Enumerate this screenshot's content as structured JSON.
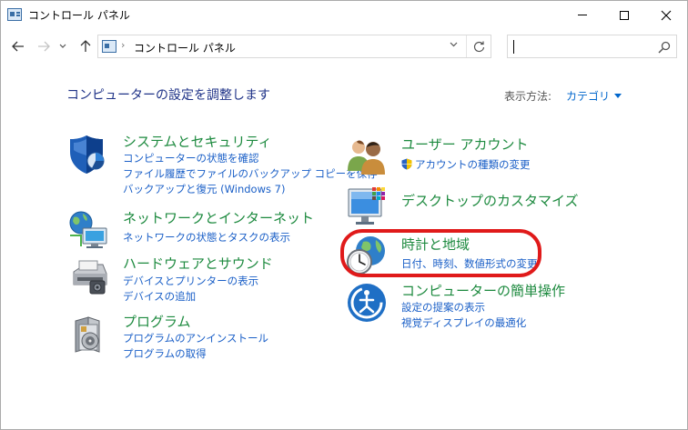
{
  "window": {
    "title": "コントロール パネル"
  },
  "addressbar": {
    "path": "コントロール パネル",
    "separator": "›"
  },
  "search": {
    "placeholder": "",
    "value": ""
  },
  "header": {
    "title": "コンピューターの設定を調整します",
    "view_by_label": "表示方法:",
    "view_by_value": "カテゴリ"
  },
  "categories": {
    "system": {
      "title": "システムとセキュリティ",
      "links": [
        "コンピューターの状態を確認",
        "ファイル履歴でファイルのバックアップ コピーを保存",
        "バックアップと復元 (Windows 7)"
      ]
    },
    "network": {
      "title": "ネットワークとインターネット",
      "links": [
        "ネットワークの状態とタスクの表示"
      ]
    },
    "hardware": {
      "title": "ハードウェアとサウンド",
      "links": [
        "デバイスとプリンターの表示",
        "デバイスの追加"
      ]
    },
    "programs": {
      "title": "プログラム",
      "links": [
        "プログラムのアンインストール",
        "プログラムの取得"
      ]
    },
    "user": {
      "title": "ユーザー アカウント",
      "links": [
        "アカウントの種類の変更"
      ]
    },
    "desktop": {
      "title": "デスクトップのカスタマイズ",
      "links": []
    },
    "clock": {
      "title": "時計と地域",
      "links": [
        "日付、時刻、数値形式の変更"
      ]
    },
    "ease": {
      "title": "コンピューターの簡単操作",
      "links": [
        "設定の提案の表示",
        "視覚ディスプレイの最適化"
      ]
    }
  },
  "colors": {
    "category_title": "#1d8a3f",
    "link": "#1a5fc7",
    "page_title": "#1e3287",
    "highlight": "#e01a1a"
  }
}
